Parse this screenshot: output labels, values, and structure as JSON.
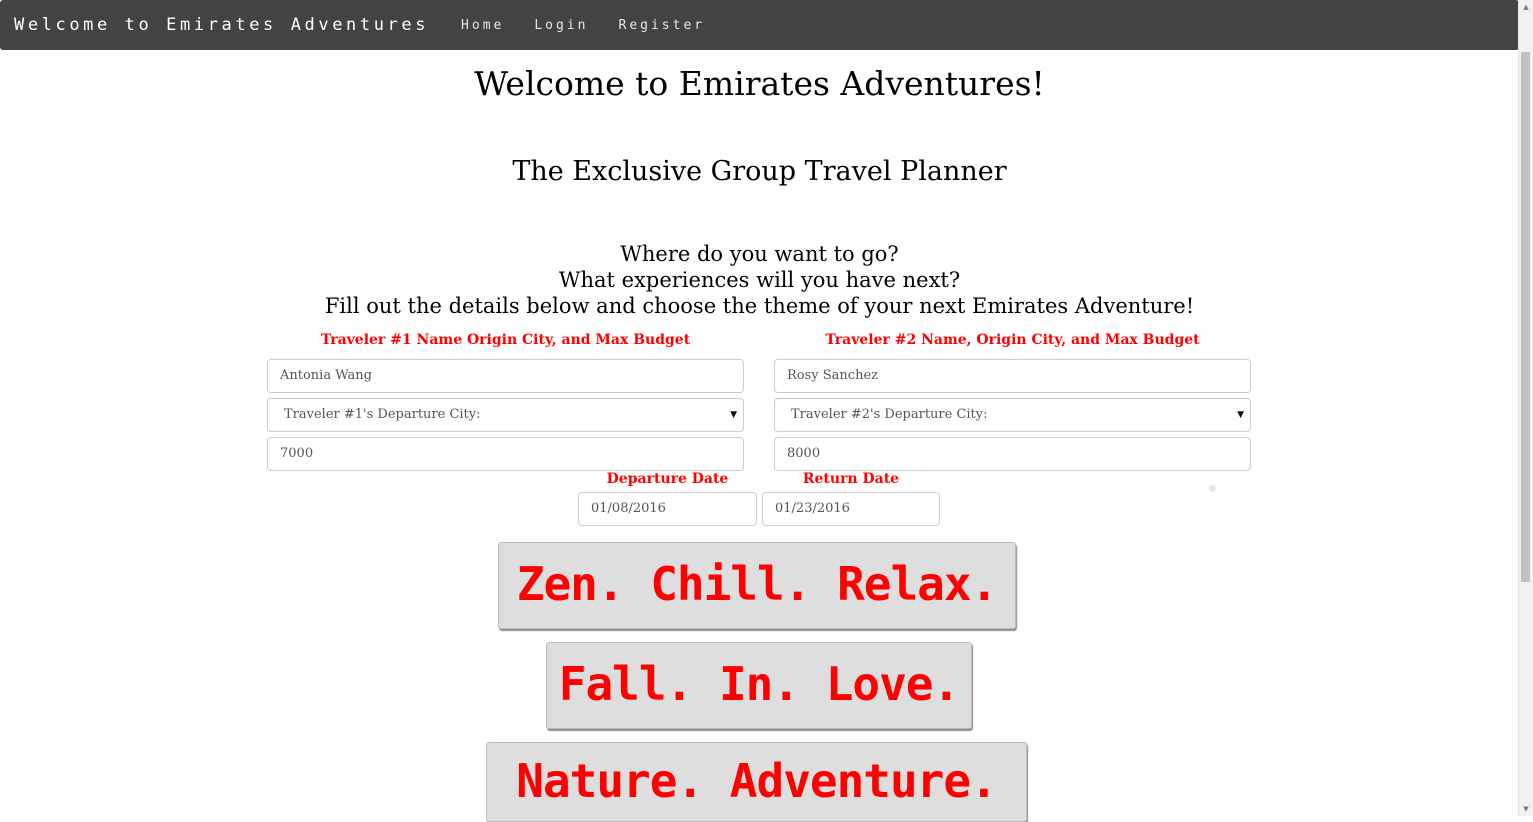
{
  "nav": {
    "brand": "Welcome to Emirates Adventures",
    "links": [
      "Home",
      "Login",
      "Register"
    ]
  },
  "header": {
    "title": "Welcome to Emirates Adventures!",
    "subtitle": "The Exclusive Group Travel Planner",
    "prompt_lines": [
      "Where do you want to go?",
      "What experiences will you have next?",
      "Fill out the details below and choose the theme of your next Emirates Adventure!"
    ]
  },
  "traveler1": {
    "label": "Traveler #1 Name Origin City, and Max Budget",
    "name": "Antonia Wang",
    "city_select": "Traveler #1's Departure City:",
    "budget": "7000"
  },
  "traveler2": {
    "label": "Traveler #2 Name, Origin City, and Max Budget",
    "name": "Rosy Sanchez",
    "city_select": "Traveler #2's Departure City:",
    "budget": "8000"
  },
  "dates": {
    "departure_label": "Departure Date",
    "return_label": "Return Date",
    "departure": "01/08/2016",
    "return": "01/23/2016"
  },
  "themes": [
    "Zen. Chill. Relax.",
    "Fall. In. Love.",
    "Nature. Adventure."
  ],
  "colors": {
    "navbar": "#434343",
    "accent": "#ff0000",
    "theme_button_bg": "#dedede"
  },
  "icons": {
    "select_arrow": "▼",
    "scroll_up": "▲",
    "scroll_down": "▼"
  }
}
